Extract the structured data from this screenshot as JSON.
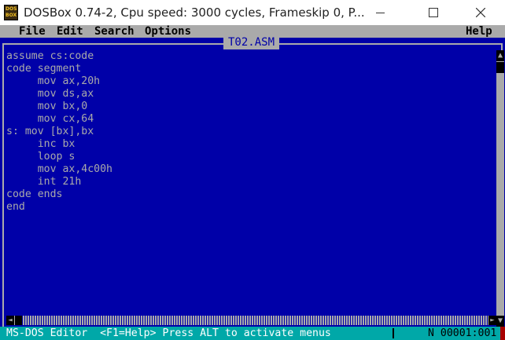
{
  "window": {
    "icon_label_top": "DOS",
    "icon_label_bottom": "BOX",
    "title": "DOSBox 0.74-2, Cpu speed:     3000 cycles, Frameskip  0, P..."
  },
  "menubar": {
    "items": [
      {
        "label": "File",
        "hotkey": "F"
      },
      {
        "label": "Edit",
        "hotkey": "E"
      },
      {
        "label": "Search",
        "hotkey": "S"
      },
      {
        "label": "Options",
        "hotkey": "O"
      }
    ],
    "help": "Help"
  },
  "editor": {
    "file_name": "T02.ASM",
    "lines": [
      "assume cs:code",
      "code segment",
      "     mov ax,20h",
      "     mov ds,ax",
      "     mov bx,0",
      "     mov cx,64",
      "s: mov [bx],bx",
      "     inc bx",
      "     loop s",
      "     mov ax,4c00h",
      "     int 21h",
      "code ends",
      "end"
    ]
  },
  "statusbar": {
    "app_name": "MS-DOS Editor",
    "hint": "<F1=Help> Press ALT to activate menus",
    "mode": "N",
    "position": "00001:001"
  },
  "icons": [
    "dosbox-icon",
    "minimize-icon",
    "maximize-icon",
    "close-icon",
    "scroll-up-icon",
    "scroll-down-icon",
    "scroll-left-icon",
    "scroll-right-icon"
  ],
  "colors": {
    "editor_bg": "#0000a8",
    "editor_text": "#aaaaaa",
    "menu_bg": "#aaaaaa",
    "status_bg": "#00a8a8"
  }
}
